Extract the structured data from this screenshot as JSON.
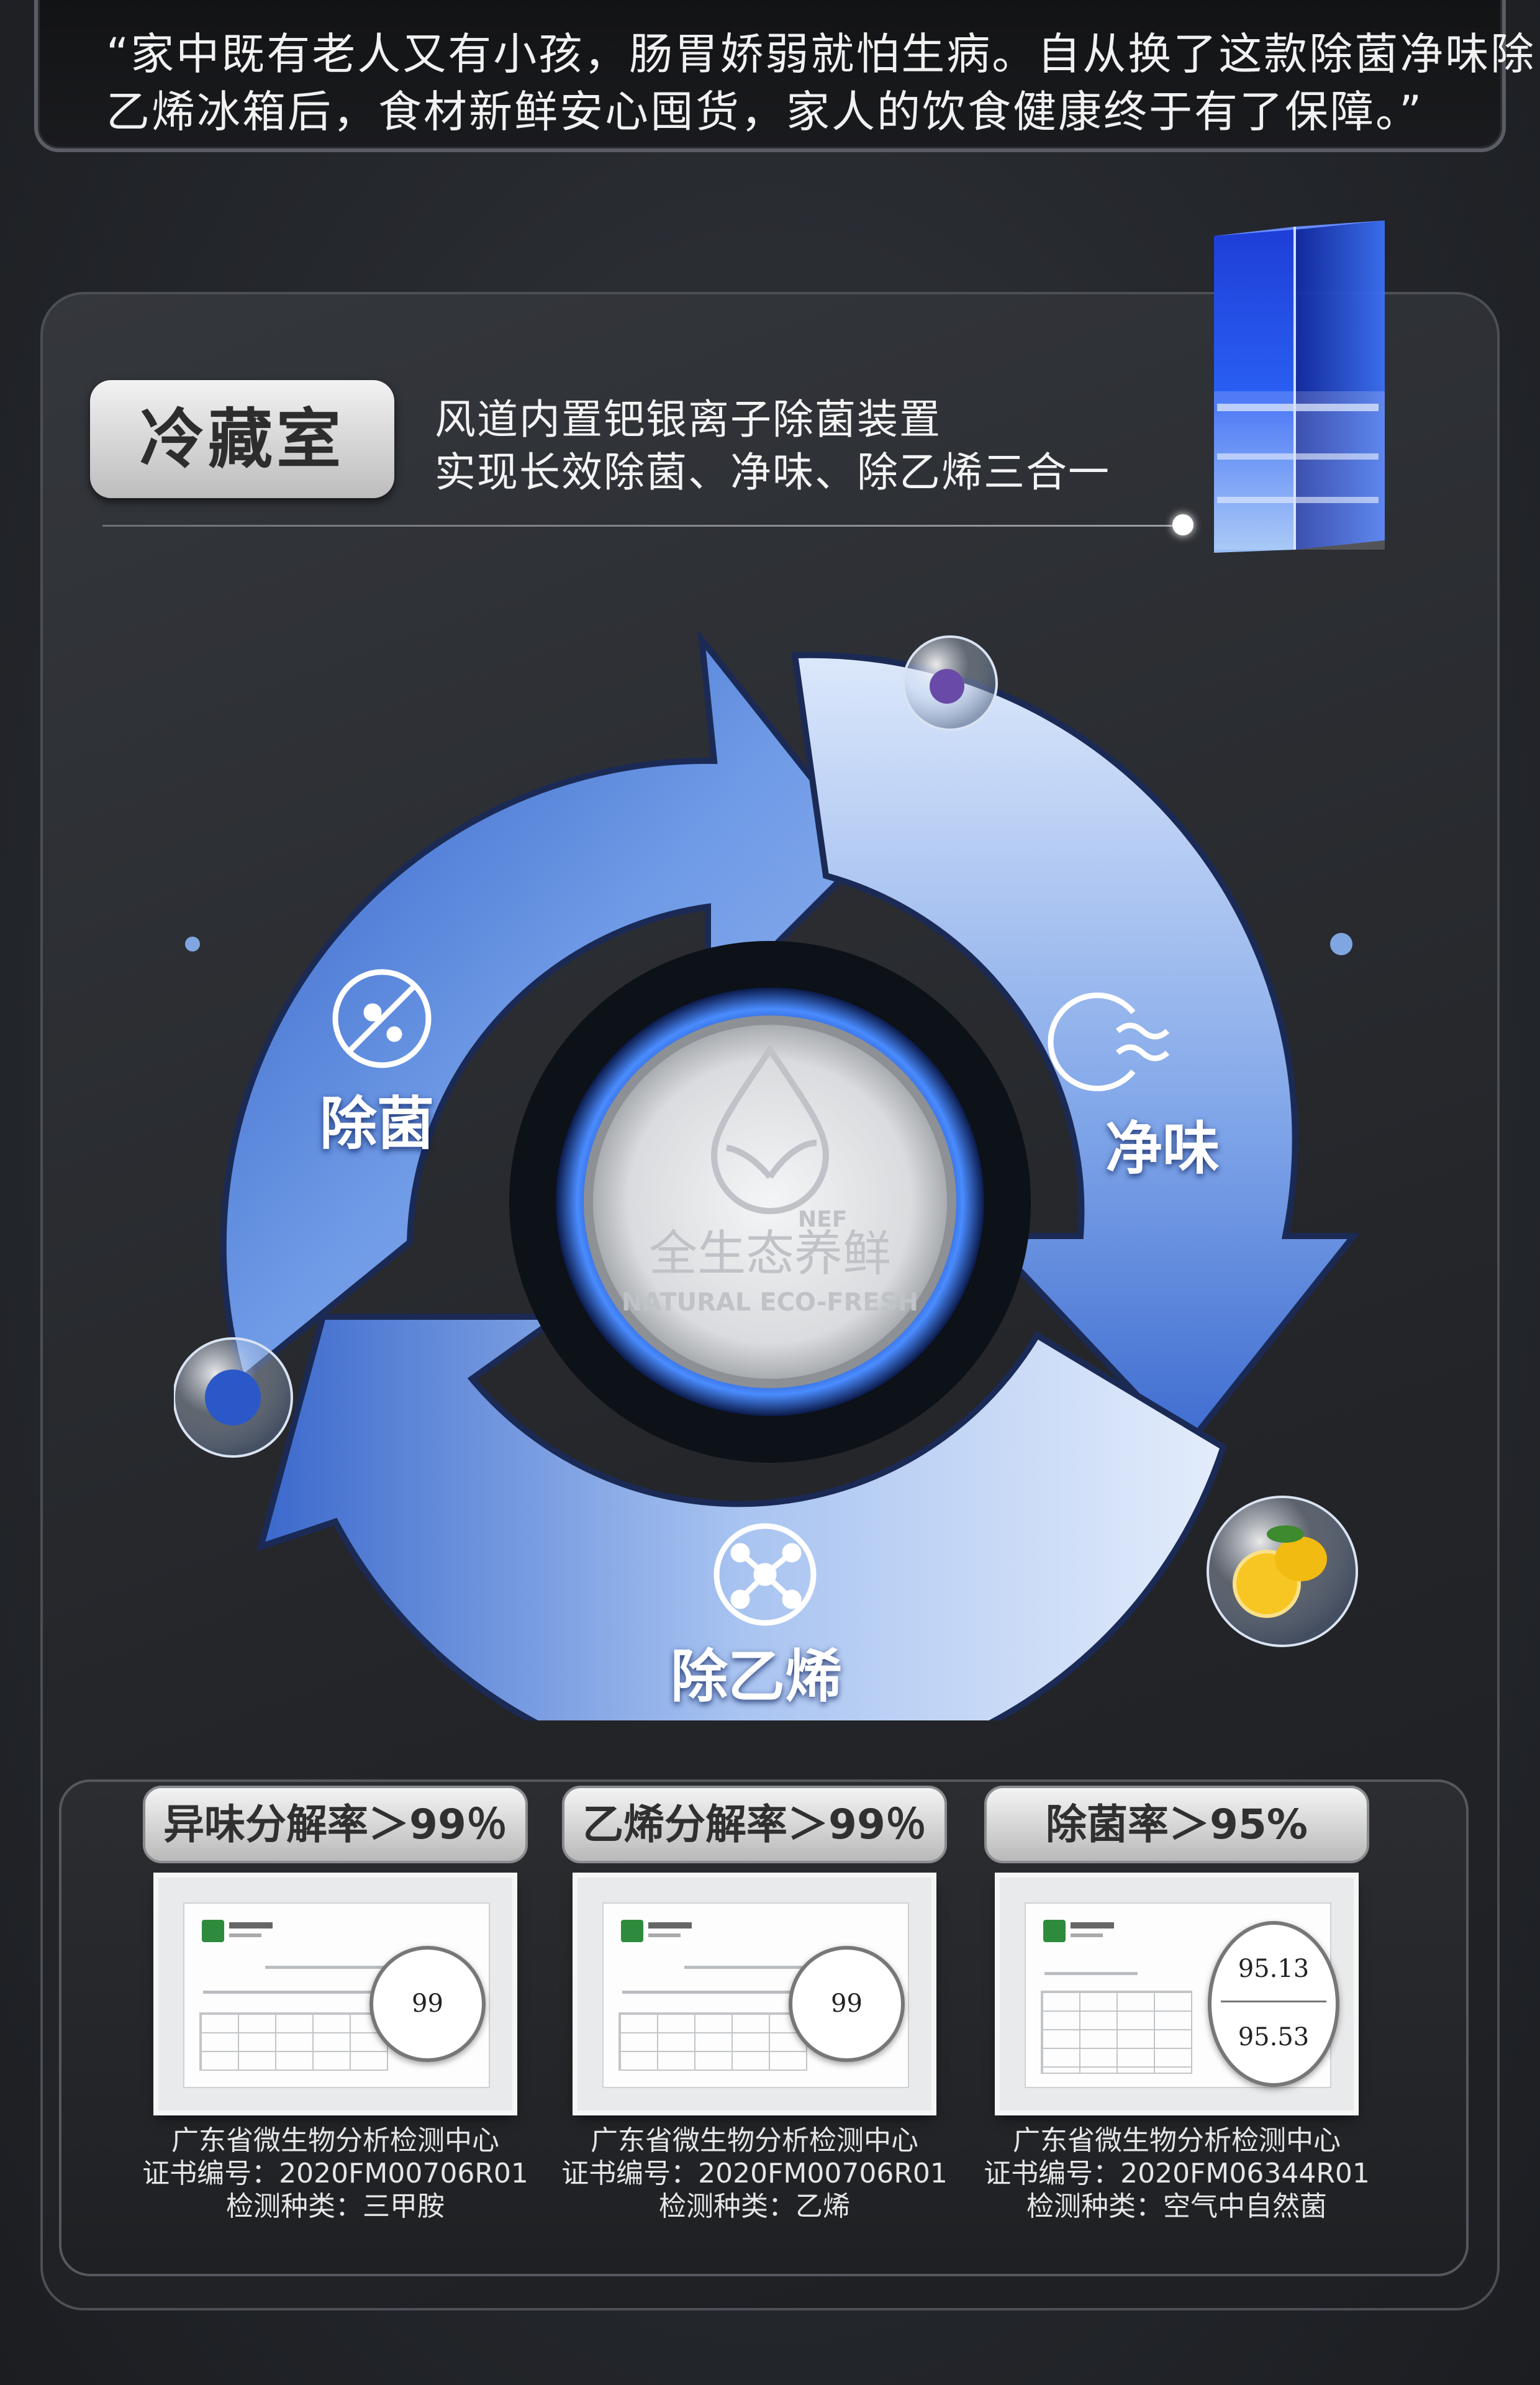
{
  "quote": {
    "line1": "“家中既有老人又有小孩，肠胃娇弱就怕生病。自从换了这款除菌净味除",
    "line2": "乙烯冰箱后，食材新鲜安心囤货，家人的饮食健康终于有了保障。”"
  },
  "feature": {
    "tag": "冷藏室",
    "desc_line1": "风道内置钯银离子除菌装置",
    "desc_line2": "实现长效除菌、净味、除乙烯三合一"
  },
  "cycle": {
    "items": [
      {
        "label": "除菌",
        "icon": "no-bacteria-icon"
      },
      {
        "label": "净味",
        "icon": "odor-removal-icon"
      },
      {
        "label": "除乙烯",
        "icon": "molecule-icon"
      }
    ],
    "center_cn": "全生态养鲜",
    "center_en": "NATURAL ECO-FRESH",
    "center_logo": "NEF"
  },
  "stats": [
    {
      "title": "异味分解率＞99％",
      "readings": [
        "99"
      ],
      "lab": "广东省微生物分析检测中心",
      "cert": "证书编号：2020FM00706R01",
      "type": "检测种类：三甲胺"
    },
    {
      "title": "乙烯分解率＞99％",
      "readings": [
        "99"
      ],
      "lab": "广东省微生物分析检测中心",
      "cert": "证书编号：2020FM00706R01",
      "type": "检测种类：乙烯"
    },
    {
      "title": "除菌率＞95%",
      "readings": [
        "95.13",
        "95.53"
      ],
      "lab": "广东省微生物分析检测中心",
      "cert": "证书编号：2020FM06344R01",
      "type": "检测种类：空气中自然菌"
    }
  ],
  "colors": {
    "arrow_blue": "#4d7fd6",
    "arrow_light": "#c7d9f5",
    "background": "#26292e"
  }
}
